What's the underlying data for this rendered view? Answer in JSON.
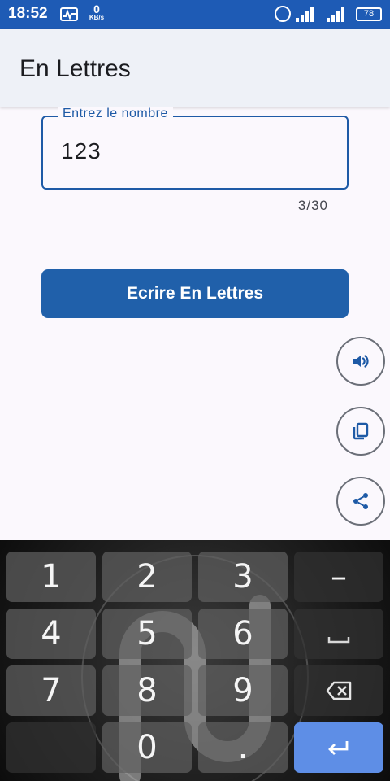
{
  "status_bar": {
    "time": "18:52",
    "net_speed": "0",
    "net_unit": "KB/s",
    "battery": "78"
  },
  "app_bar": {
    "title": "En Lettres"
  },
  "input": {
    "label": "Entrez le nombre",
    "value": "123",
    "counter": "3/30"
  },
  "primary_button": {
    "label": "Ecrire En Lettres"
  },
  "fabs": [
    {
      "icon": "volume-icon"
    },
    {
      "icon": "copy-icon"
    },
    {
      "icon": "share-icon"
    }
  ],
  "keyboard": {
    "keys": [
      "1",
      "2",
      "3",
      "–",
      "4",
      "5",
      "6",
      "7",
      "8",
      "9",
      "0",
      "."
    ],
    "extra_icons": [
      "space-icon",
      "backspace-icon",
      "enter-icon"
    ]
  },
  "colors": {
    "status_bar": "#1e5bb5",
    "accent": "#1e5aa6",
    "button": "#2060aa",
    "enter_key": "#5e8ee6"
  }
}
